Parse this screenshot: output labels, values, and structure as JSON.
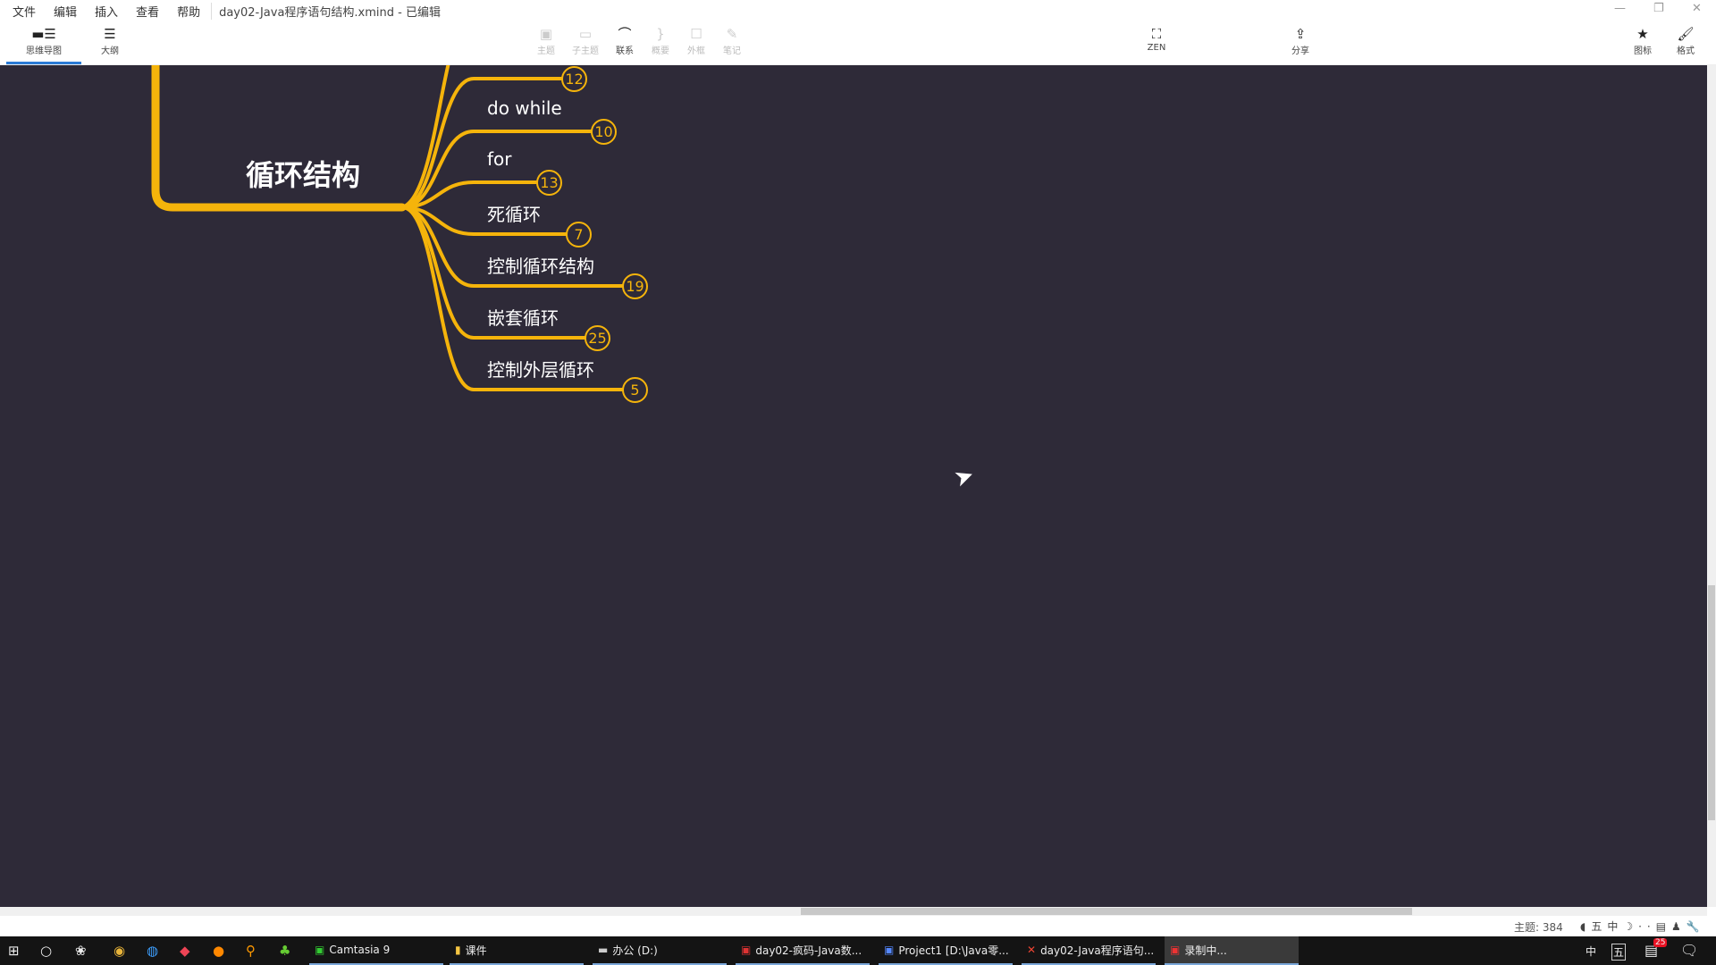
{
  "menu": {
    "items": [
      "文件",
      "编辑",
      "插入",
      "查看",
      "帮助"
    ],
    "title": "day02-Java程序语句结构.xmind - 已编辑"
  },
  "toolbar": {
    "mindmap": "思维导图",
    "outline": "大纲",
    "topic": "主题",
    "subtopic": "子主题",
    "relationship": "联系",
    "summary": "概要",
    "boundary": "外框",
    "note": "笔记",
    "zen": "ZEN",
    "share": "分享",
    "icon": "图标",
    "format": "格式"
  },
  "mindmap": {
    "central": "循环结构",
    "branch_color": "#f5b40b",
    "background": "#2e2a38",
    "children": [
      {
        "label": "",
        "count": "12"
      },
      {
        "label": "do while",
        "count": "10"
      },
      {
        "label": "for",
        "count": "13"
      },
      {
        "label": "死循环",
        "count": "7"
      },
      {
        "label": "控制循环结构",
        "count": "19"
      },
      {
        "label": "嵌套循环",
        "count": "25"
      },
      {
        "label": "控制外层循环",
        "count": "5"
      }
    ]
  },
  "status": {
    "topics": "主题: 384"
  },
  "taskbar": {
    "apps": [
      "Camtasia 9",
      "课件",
      "办公 (D:)",
      "day02-疯码-Java数...",
      "Project1 [D:\\Java零...",
      "day02-Java程序语句...",
      "录制中..."
    ],
    "tray": {
      "lang": "中",
      "ime": "五",
      "notify_count": "25"
    }
  }
}
